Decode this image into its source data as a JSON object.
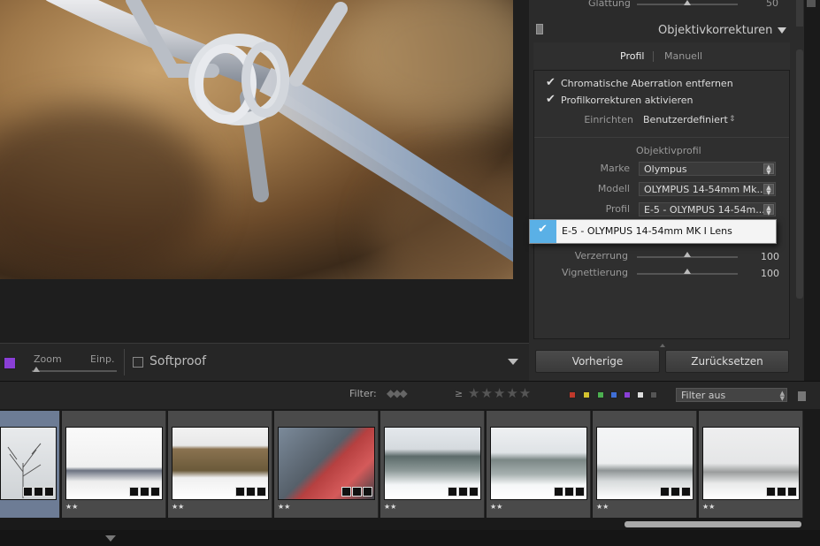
{
  "toolbar": {
    "zoom_label": "Zoom",
    "fit_label": "Einp.",
    "softproof_label": "Softproof",
    "softproof_checked": false,
    "swatch_color": "#8a3fd6"
  },
  "panel": {
    "glaettung_label": "Glättung",
    "glaettung_value": "50",
    "section_title": "Objektivkorrekturen",
    "tabs": {
      "profil": "Profil",
      "manuell": "Manuell"
    },
    "checkbox_ca": "Chromatische Aberration entfernen",
    "checkbox_profil": "Profilkorrekturen aktivieren",
    "einrichten_label": "Einrichten",
    "einrichten_value": "Benutzerdefiniert",
    "objektivprofil_title": "Objektivprofil",
    "marke_label": "Marke",
    "marke_value": "Olympus",
    "modell_label": "Modell",
    "modell_value": "OLYMPUS 14-54mm Mk...",
    "profil_label": "Profil",
    "profil_value": "E-5 - OLYMPUS 14-54m...",
    "popup_option": "E-5 - OLYMPUS 14-54mm MK I Lens",
    "verzerrung_label": "Verzerrung",
    "verzerrung_value": "100",
    "vignettierung_label": "Vignettierung",
    "vignettierung_value": "100",
    "btn_previous": "Vorherige",
    "btn_reset": "Zurücksetzen"
  },
  "filter": {
    "label": "Filter:",
    "ge": "≥",
    "stars": "★★★★★",
    "color_labels": [
      "#c0392b",
      "#d4c22f",
      "#4caf50",
      "#3f6fd6",
      "#8a3fd6",
      "#dddddd",
      "#555555"
    ],
    "select_value": "Filter aus"
  },
  "filmstrip": {
    "items": [
      {
        "stars": ""
      },
      {
        "stars": "★★"
      },
      {
        "stars": "★★"
      },
      {
        "stars": "★★"
      },
      {
        "stars": "★★"
      },
      {
        "stars": "★★"
      },
      {
        "stars": "★★"
      },
      {
        "stars": "★★"
      }
    ]
  }
}
